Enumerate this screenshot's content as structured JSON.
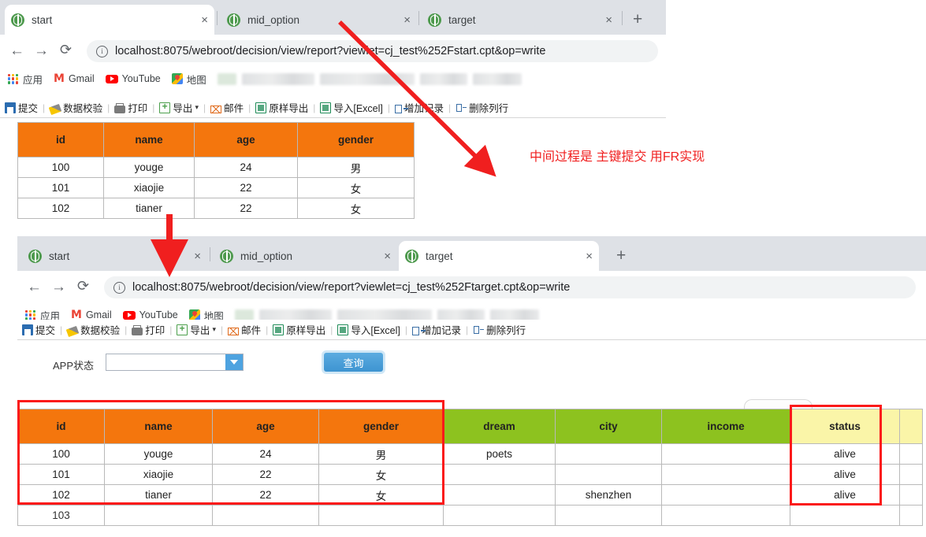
{
  "windows": [
    {
      "tabs": [
        {
          "title": "start",
          "active": true,
          "close": "×"
        },
        {
          "title": "mid_option",
          "active": false,
          "close": "×"
        },
        {
          "title": "target",
          "active": false,
          "close": "×"
        }
      ],
      "newtab": "+",
      "nav": {
        "back": "←",
        "forward": "→",
        "reload": "⟳",
        "info": "i"
      },
      "url": "localhost:8075/webroot/decision/view/report?viewlet=cj_test%252Fstart.cpt&op=write",
      "bookmarks": [
        {
          "label": "应用",
          "icon": "apps-grid-icon"
        },
        {
          "label": "Gmail",
          "icon": "gmail-icon"
        },
        {
          "label": "YouTube",
          "icon": "youtube-icon"
        },
        {
          "label": "地图",
          "icon": "maps-icon"
        }
      ]
    },
    {
      "tabs": [
        {
          "title": "start",
          "active": false,
          "close": "×"
        },
        {
          "title": "mid_option",
          "active": false,
          "close": "×"
        },
        {
          "title": "target",
          "active": true,
          "close": "×"
        }
      ],
      "newtab": "+",
      "nav": {
        "back": "←",
        "forward": "→",
        "reload": "⟳",
        "info": "i"
      },
      "url": "localhost:8075/webroot/decision/view/report?viewlet=cj_test%252Ftarget.cpt&op=write",
      "bookmarks": [
        {
          "label": "应用",
          "icon": "apps-grid-icon"
        },
        {
          "label": "Gmail",
          "icon": "gmail-icon"
        },
        {
          "label": "YouTube",
          "icon": "youtube-icon"
        },
        {
          "label": "地图",
          "icon": "maps-icon"
        }
      ]
    }
  ],
  "report_toolbar": {
    "items": [
      {
        "label": "提交",
        "icon": "save-icon"
      },
      {
        "label": "数据校验",
        "icon": "check-icon"
      },
      {
        "label": "打印",
        "icon": "print-icon"
      },
      {
        "label": "导出",
        "icon": "export-icon",
        "caret": "▾"
      },
      {
        "label": "邮件",
        "icon": "mail-icon"
      },
      {
        "label": "原样导出",
        "icon": "excel-icon"
      },
      {
        "label": "导入[Excel]",
        "icon": "excel-import-icon"
      },
      {
        "label": "增加记录",
        "icon": "add-row-icon"
      },
      {
        "label": "删除列行",
        "icon": "delete-row-icon"
      }
    ],
    "separator": "|"
  },
  "start_table": {
    "headers": [
      "id",
      "name",
      "age",
      "gender"
    ],
    "rows": [
      [
        "100",
        "youge",
        "24",
        "男"
      ],
      [
        "101",
        "xiaojie",
        "22",
        "女"
      ],
      [
        "102",
        "tianer",
        "22",
        "女"
      ]
    ]
  },
  "query_form": {
    "label": "APP状态",
    "select_value": "",
    "button": "查询"
  },
  "target_table": {
    "headers": [
      "id",
      "name",
      "age",
      "gender",
      "dream",
      "city",
      "income",
      "status"
    ],
    "header_colors": [
      "#f4760d",
      "#f4760d",
      "#f4760d",
      "#f4760d",
      "#8dc21f",
      "#8dc21f",
      "#8dc21f",
      "#faf5a8"
    ],
    "rows": [
      [
        "100",
        "youge",
        "24",
        "男",
        "poets",
        "",
        "",
        "alive"
      ],
      [
        "101",
        "xiaojie",
        "22",
        "女",
        "",
        "",
        "",
        "alive"
      ],
      [
        "102",
        "tianer",
        "22",
        "女",
        "",
        "shenzhen",
        "",
        "alive"
      ],
      [
        "103",
        "",
        "",
        "",
        "",
        "",
        "",
        ""
      ]
    ]
  },
  "annotations": {
    "note": "中间过程是 主键提交 用FR实现",
    "accent_color": "#fb1a1a"
  }
}
